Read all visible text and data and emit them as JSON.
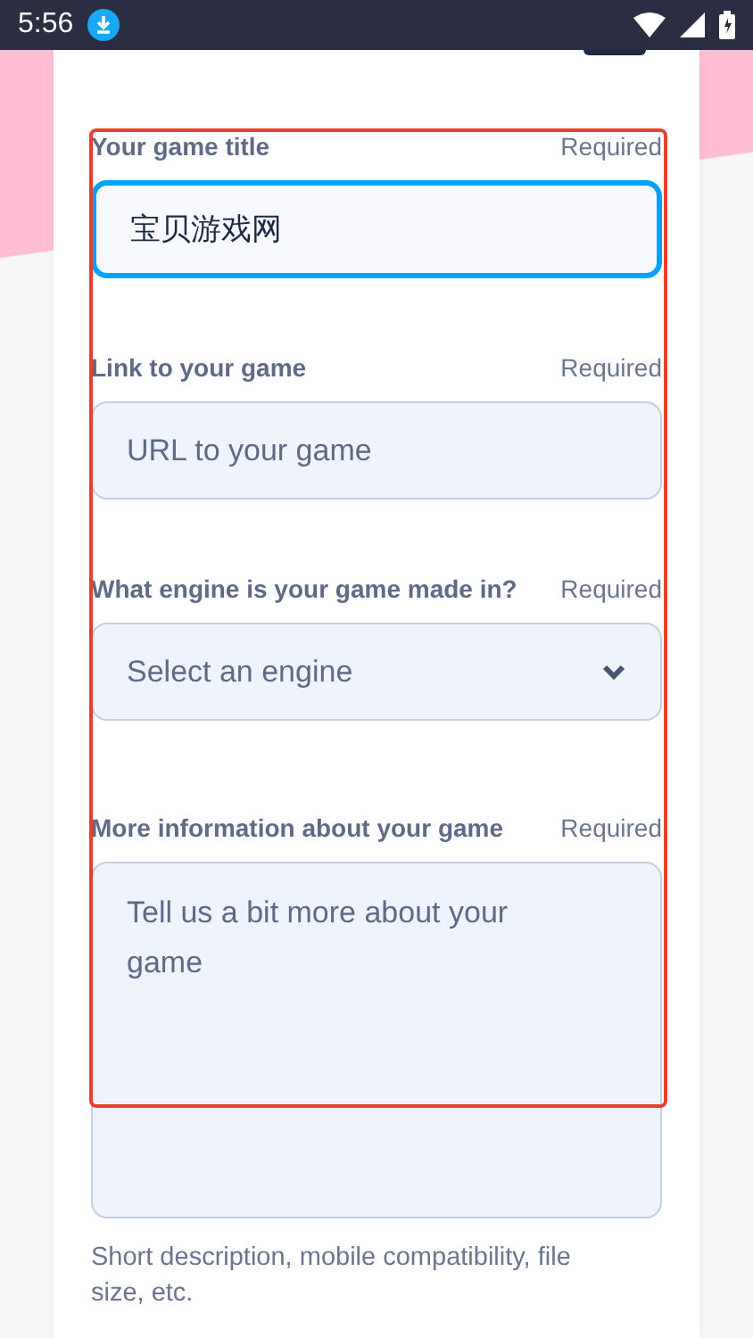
{
  "status_bar": {
    "time": "5:56"
  },
  "fields": [
    {
      "kind": "text",
      "label": "Your game title",
      "required": "Required",
      "value": "宝贝游戏网",
      "focused": true
    },
    {
      "kind": "text",
      "label": "Link to your game",
      "required": "Required",
      "placeholder": "URL to your game",
      "focused": false
    },
    {
      "kind": "select",
      "label": "What engine is your game made in?",
      "required": "Required",
      "placeholder": "Select an engine",
      "focused": false
    },
    {
      "kind": "textarea",
      "label": "More information about your game",
      "required": "Required",
      "placeholder": "Tell us a bit more about your game",
      "focused": false,
      "help": "Short description, mobile compatibility, file size, etc."
    }
  ],
  "highlight": true
}
